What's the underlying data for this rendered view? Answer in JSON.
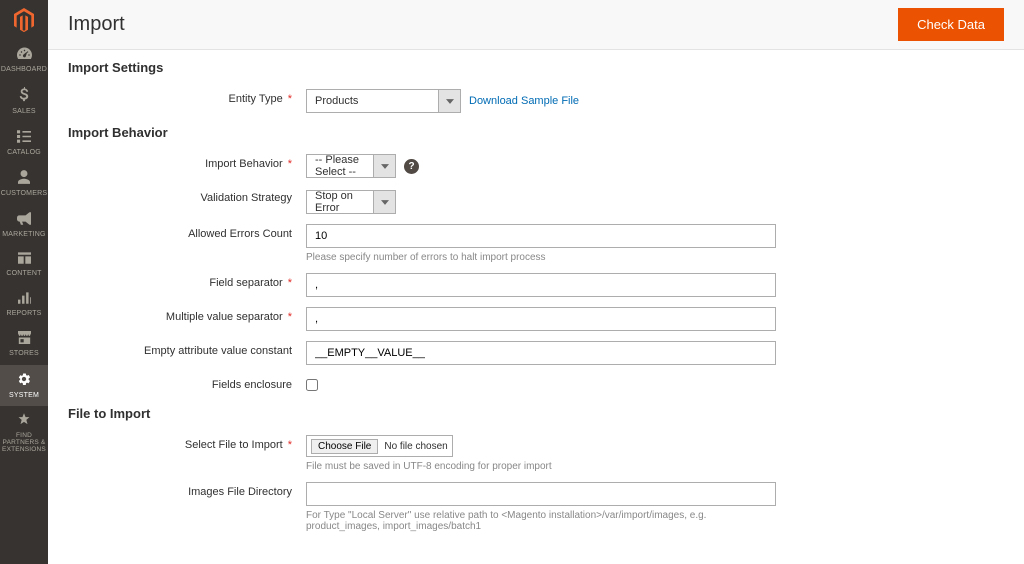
{
  "header": {
    "title": "Import",
    "check_data_label": "Check Data"
  },
  "sidebar": {
    "items": [
      {
        "label": "DASHBOARD"
      },
      {
        "label": "SALES"
      },
      {
        "label": "CATALOG"
      },
      {
        "label": "CUSTOMERS"
      },
      {
        "label": "MARKETING"
      },
      {
        "label": "CONTENT"
      },
      {
        "label": "REPORTS"
      },
      {
        "label": "STORES"
      },
      {
        "label": "SYSTEM"
      },
      {
        "label": "FIND PARTNERS & EXTENSIONS"
      }
    ]
  },
  "sections": {
    "import_settings": {
      "title": "Import Settings",
      "entity_type": {
        "label": "Entity Type",
        "value": "Products",
        "sample_link": "Download Sample File"
      }
    },
    "import_behavior": {
      "title": "Import Behavior",
      "behavior": {
        "label": "Import Behavior",
        "value": "-- Please Select --"
      },
      "validation_strategy": {
        "label": "Validation Strategy",
        "value": "Stop on Error"
      },
      "allowed_errors": {
        "label": "Allowed Errors Count",
        "value": "10",
        "note": "Please specify number of errors to halt import process"
      },
      "field_separator": {
        "label": "Field separator",
        "value": ","
      },
      "multi_value_separator": {
        "label": "Multiple value separator",
        "value": ","
      },
      "empty_attribute": {
        "label": "Empty attribute value constant",
        "value": "__EMPTY__VALUE__"
      },
      "fields_enclosure": {
        "label": "Fields enclosure"
      }
    },
    "file_to_import": {
      "title": "File to Import",
      "select_file": {
        "label": "Select File to Import",
        "button": "Choose File",
        "status": "No file chosen",
        "note": "File must be saved in UTF-8 encoding for proper import"
      },
      "images_dir": {
        "label": "Images File Directory",
        "value": "",
        "note": "For Type \"Local Server\" use relative path to <Magento installation>/var/import/images, e.g. product_images, import_images/batch1"
      }
    }
  }
}
